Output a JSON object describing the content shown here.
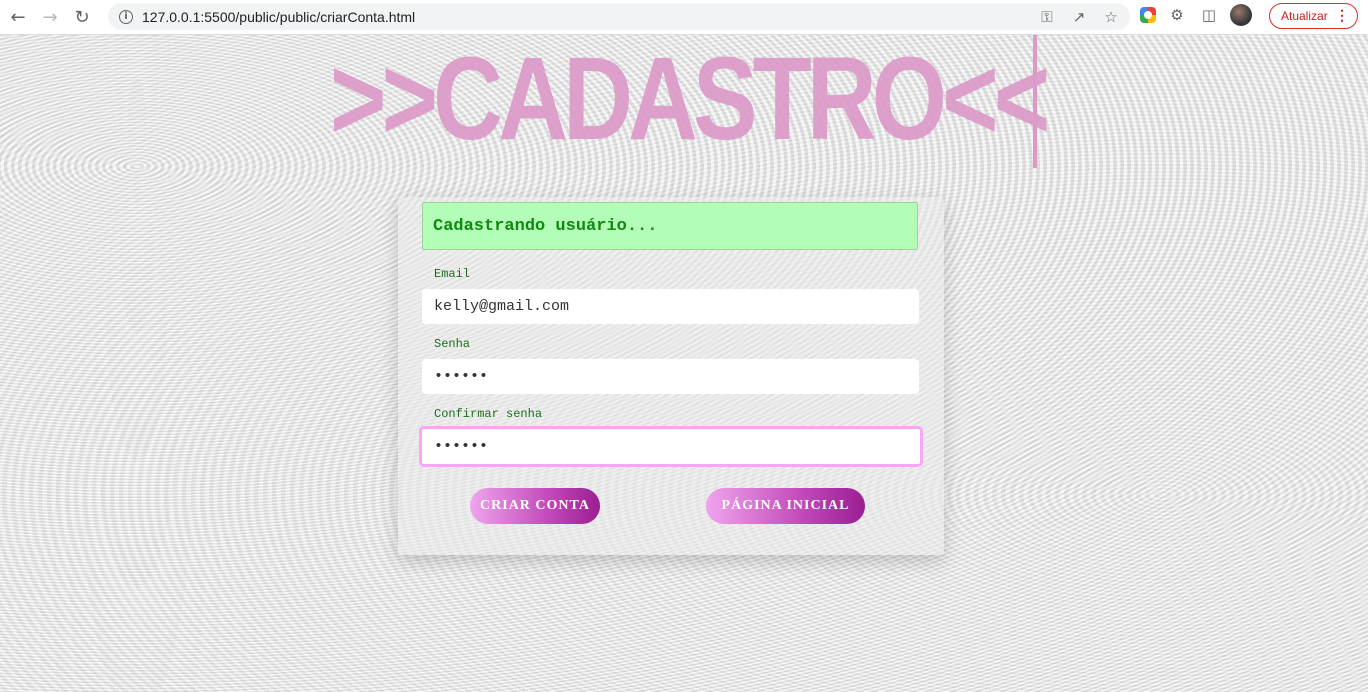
{
  "browser": {
    "url": "127.0.0.1:5500/public/public/criarConta.html",
    "update_label": "Atualizar"
  },
  "page": {
    "title": ">>CADASTRO<<",
    "status_message": "Cadastrando usuário...",
    "form": {
      "email_label": "Email",
      "email_value": "kelly@gmail.com",
      "password_label": "Senha",
      "password_value": "••••••",
      "confirm_label": "Confirmar senha",
      "confirm_value": "••••••"
    },
    "buttons": {
      "create_account": "CRIAR CONTA",
      "home_page": "PÁGINA INICIAL"
    }
  },
  "colors": {
    "title": "#dc9ac9",
    "status_bg": "#b3fdb8",
    "status_text": "#0f8a0f",
    "focus_border": "#f9a7f4",
    "button_gradient_end": "#9b1e93"
  }
}
